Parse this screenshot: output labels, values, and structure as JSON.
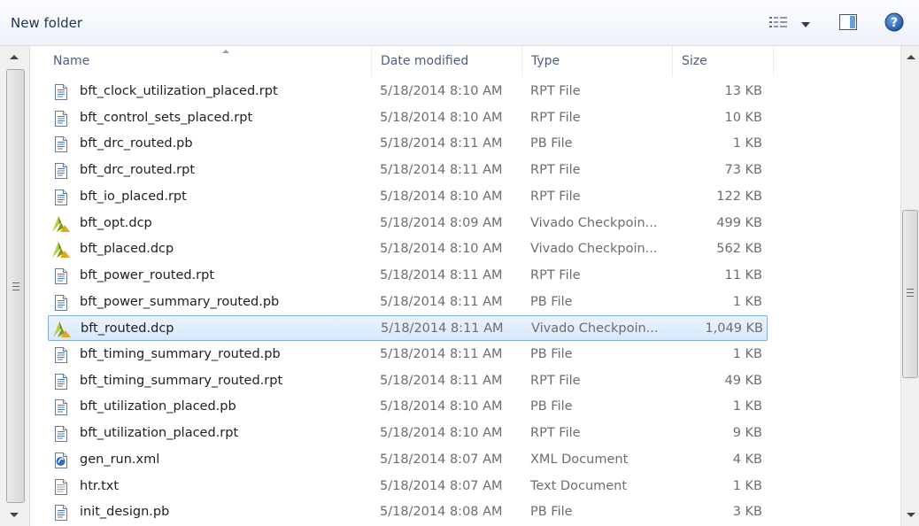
{
  "window": {
    "title": "New folder"
  },
  "toolbar": {
    "views_icon": "details-view-icon",
    "dropdown_icon": "chevron-down-icon",
    "preview_icon": "preview-pane-icon",
    "help_icon": "help-icon"
  },
  "columns": {
    "name": "Name",
    "date": "Date modified",
    "type": "Type",
    "size": "Size"
  },
  "files": [
    {
      "name": "bft_clock_utilization_placed.rpt",
      "date": "5/18/2014 8:10 AM",
      "type": "RPT File",
      "size": "13 KB",
      "icon": "document-icon"
    },
    {
      "name": "bft_control_sets_placed.rpt",
      "date": "5/18/2014 8:10 AM",
      "type": "RPT File",
      "size": "10 KB",
      "icon": "document-icon"
    },
    {
      "name": "bft_drc_routed.pb",
      "date": "5/18/2014 8:11 AM",
      "type": "PB File",
      "size": "1 KB",
      "icon": "document-icon"
    },
    {
      "name": "bft_drc_routed.rpt",
      "date": "5/18/2014 8:11 AM",
      "type": "RPT File",
      "size": "73 KB",
      "icon": "document-icon"
    },
    {
      "name": "bft_io_placed.rpt",
      "date": "5/18/2014 8:10 AM",
      "type": "RPT File",
      "size": "122 KB",
      "icon": "document-icon"
    },
    {
      "name": "bft_opt.dcp",
      "date": "5/18/2014 8:09 AM",
      "type": "Vivado Checkpoin...",
      "size": "499 KB",
      "icon": "vivado-icon"
    },
    {
      "name": "bft_placed.dcp",
      "date": "5/18/2014 8:10 AM",
      "type": "Vivado Checkpoin...",
      "size": "562 KB",
      "icon": "vivado-icon"
    },
    {
      "name": "bft_power_routed.rpt",
      "date": "5/18/2014 8:11 AM",
      "type": "RPT File",
      "size": "11 KB",
      "icon": "document-icon"
    },
    {
      "name": "bft_power_summary_routed.pb",
      "date": "5/18/2014 8:11 AM",
      "type": "PB File",
      "size": "1 KB",
      "icon": "document-icon"
    },
    {
      "name": "bft_routed.dcp",
      "date": "5/18/2014 8:11 AM",
      "type": "Vivado Checkpoin...",
      "size": "1,049 KB",
      "icon": "vivado-icon",
      "selected": true
    },
    {
      "name": "bft_timing_summary_routed.pb",
      "date": "5/18/2014 8:11 AM",
      "type": "PB File",
      "size": "1 KB",
      "icon": "document-icon"
    },
    {
      "name": "bft_timing_summary_routed.rpt",
      "date": "5/18/2014 8:11 AM",
      "type": "RPT File",
      "size": "49 KB",
      "icon": "document-icon"
    },
    {
      "name": "bft_utilization_placed.pb",
      "date": "5/18/2014 8:10 AM",
      "type": "PB File",
      "size": "1 KB",
      "icon": "document-icon"
    },
    {
      "name": "bft_utilization_placed.rpt",
      "date": "5/18/2014 8:10 AM",
      "type": "RPT File",
      "size": "9 KB",
      "icon": "document-icon"
    },
    {
      "name": "gen_run.xml",
      "date": "5/18/2014 8:07 AM",
      "type": "XML Document",
      "size": "4 KB",
      "icon": "xml-document-icon"
    },
    {
      "name": "htr.txt",
      "date": "5/18/2014 8:07 AM",
      "type": "Text Document",
      "size": "1 KB",
      "icon": "text-document-icon"
    },
    {
      "name": "init_design.pb",
      "date": "5/18/2014 8:08 AM",
      "type": "PB File",
      "size": "3 KB",
      "icon": "document-icon"
    }
  ],
  "colors": {
    "selection_border": "#84acdd",
    "header_text": "#4c607a",
    "secondary_text": "#6d6d6d"
  }
}
